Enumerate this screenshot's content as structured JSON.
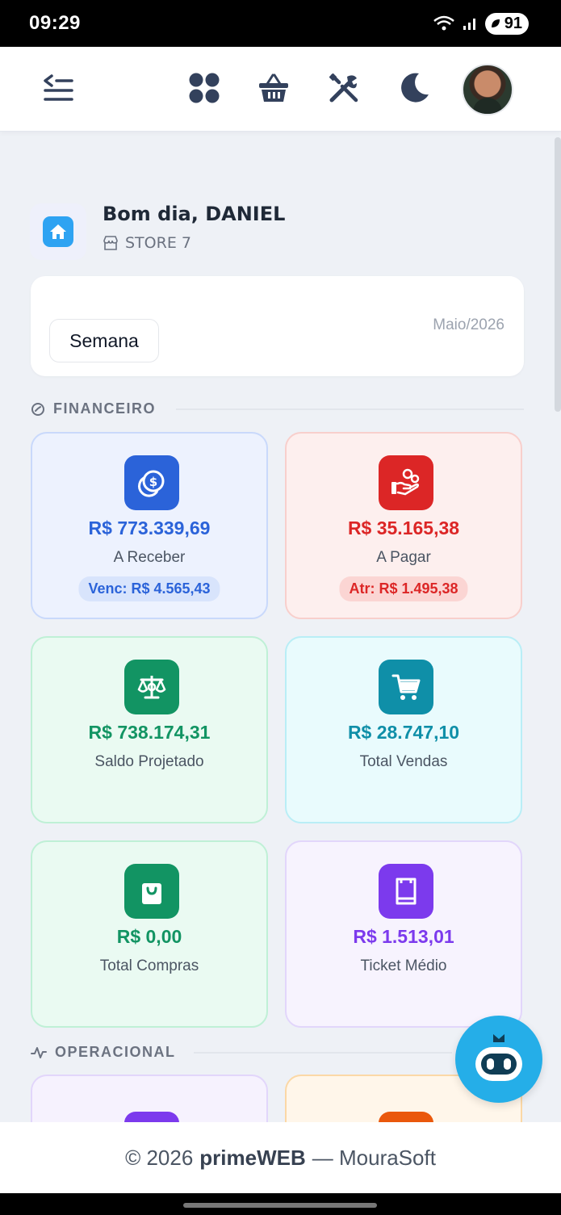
{
  "status_bar": {
    "time": "09:29",
    "battery": "91"
  },
  "header": {
    "icons": [
      "menu-collapse-icon",
      "apps-grid-icon",
      "basket-icon",
      "tools-icon",
      "moon-icon"
    ],
    "avatar_alt": "user-avatar"
  },
  "greeting": {
    "text": "Bom dia, DANIEL",
    "store": "STORE 7"
  },
  "period": {
    "button": "Semana",
    "month": "Maio/2026"
  },
  "sections": {
    "financeiro": "FINANCEIRO",
    "operacional": "OPERACIONAL"
  },
  "cards": [
    {
      "value": "R$ 773.339,69",
      "label": "A Receber",
      "chip": "Venc: R$ 4.565,43",
      "accent": "#2b63d9",
      "bg": "#edf2fe",
      "border": "#c9d9fb",
      "chip_bg": "#d8e4fc",
      "icon": "coins-icon"
    },
    {
      "value": "R$ 35.165,38",
      "label": "A Pagar",
      "chip": "Atr: R$ 1.495,38",
      "accent": "#dc2626",
      "bg": "#fdefee",
      "border": "#f8cfcc",
      "chip_bg": "#fbd5d3",
      "icon": "hand-coins-icon"
    },
    {
      "value": "R$ 738.174,31",
      "label": "Saldo Projetado",
      "accent": "#129463",
      "bg": "#eafaf2",
      "border": "#bff0d6",
      "icon": "scale-icon"
    },
    {
      "value": "R$ 28.747,10",
      "label": "Total Vendas",
      "accent": "#0f8fa8",
      "bg": "#e9fbfd",
      "border": "#b9eef6",
      "icon": "cart-icon"
    },
    {
      "value": "R$ 0,00",
      "label": "Total Compras",
      "accent": "#129463",
      "bg": "#eafaf2",
      "border": "#bff0d6",
      "icon": "shopping-bag-icon"
    },
    {
      "value": "R$ 1.513,01",
      "label": "Ticket Médio",
      "accent": "#7c3aed",
      "bg": "#f7f3fe",
      "border": "#e2d6fb",
      "icon": "receipt-icon"
    }
  ],
  "footer": {
    "copyright": "© 2026",
    "brand": "primeWEB",
    "suffix": "— MouraSoft"
  }
}
